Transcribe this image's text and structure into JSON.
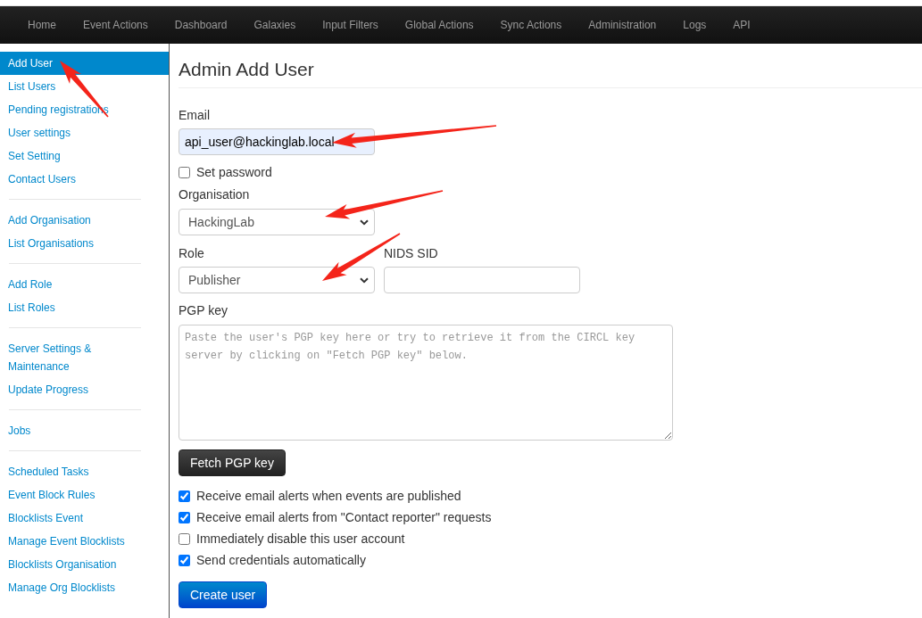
{
  "navbar": {
    "items": [
      "Home",
      "Event Actions",
      "Dashboard",
      "Galaxies",
      "Input Filters",
      "Global Actions",
      "Sync Actions",
      "Administration",
      "Logs",
      "API"
    ]
  },
  "sidebar": {
    "sections": [
      {
        "items": [
          {
            "label": "Add User",
            "selected": true
          },
          {
            "label": "List Users",
            "selected": false
          },
          {
            "label": "Pending registrations",
            "selected": false
          },
          {
            "label": "User settings",
            "selected": false
          },
          {
            "label": "Set Setting",
            "selected": false
          },
          {
            "label": "Contact Users",
            "selected": false
          }
        ]
      },
      {
        "items": [
          {
            "label": "Add Organisation",
            "selected": false
          },
          {
            "label": "List Organisations",
            "selected": false
          }
        ]
      },
      {
        "items": [
          {
            "label": "Add Role",
            "selected": false
          },
          {
            "label": "List Roles",
            "selected": false
          }
        ]
      },
      {
        "items": [
          {
            "label": "Server Settings & Maintenance",
            "selected": false
          },
          {
            "label": "Update Progress",
            "selected": false
          }
        ]
      },
      {
        "items": [
          {
            "label": "Jobs",
            "selected": false
          }
        ]
      },
      {
        "items": [
          {
            "label": "Scheduled Tasks",
            "selected": false
          },
          {
            "label": "Event Block Rules",
            "selected": false
          },
          {
            "label": "Blocklists Event",
            "selected": false
          },
          {
            "label": "Manage Event Blocklists",
            "selected": false
          },
          {
            "label": "Blocklists Organisation",
            "selected": false
          },
          {
            "label": "Manage Org Blocklists",
            "selected": false
          }
        ]
      }
    ]
  },
  "form": {
    "title": "Admin Add User",
    "email": {
      "label": "Email",
      "value": "api_user@hackinglab.local"
    },
    "set_password": {
      "label": "Set password",
      "checked": false
    },
    "organisation": {
      "label": "Organisation",
      "value": "HackingLab"
    },
    "role": {
      "label": "Role",
      "value": "Publisher"
    },
    "nids_sid": {
      "label": "NIDS SID"
    },
    "pgp_key": {
      "label": "PGP key",
      "placeholder": "Paste the user's PGP key here or try to retrieve it from the CIRCL key server by clicking on \"Fetch PGP key\" below."
    },
    "fetch_button": "Fetch PGP key",
    "options": [
      {
        "label": "Receive email alerts when events are published",
        "checked": true
      },
      {
        "label": "Receive email alerts from \"Contact reporter\" requests",
        "checked": true
      },
      {
        "label": "Immediately disable this user account",
        "checked": false
      },
      {
        "label": "Send credentials automatically",
        "checked": true
      }
    ],
    "submit_button": "Create user"
  }
}
